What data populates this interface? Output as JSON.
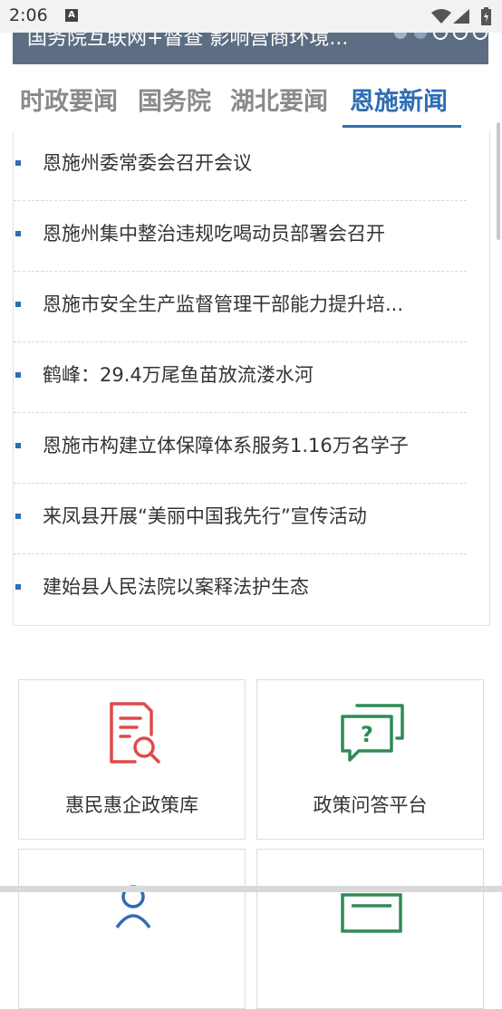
{
  "status_bar": {
    "time": "2:06",
    "notification_glyph": "A",
    "icons": [
      "wifi-icon",
      "signal-icon",
      "battery-icon"
    ]
  },
  "banner": {
    "caption": "国务院互联网+督查 影响营商环境..."
  },
  "tabs": [
    {
      "label": "时政要闻",
      "active": false
    },
    {
      "label": "国务院",
      "active": false
    },
    {
      "label": "湖北要闻",
      "active": false
    },
    {
      "label": "恩施新闻",
      "active": true
    }
  ],
  "news": [
    {
      "title": "恩施州委常委会召开会议"
    },
    {
      "title": "恩施州集中整治违规吃喝动员部署会召开"
    },
    {
      "title": "恩施市安全生产监督管理干部能力提升培..."
    },
    {
      "title": "鹤峰：29.4万尾鱼苗放流溇水河"
    },
    {
      "title": "恩施市构建立体保障体系服务1.16万名学子"
    },
    {
      "title": "来凤县开展“美丽中国我先行”宣传活动"
    },
    {
      "title": "建始县人民法院以案释法护生态"
    }
  ],
  "services": [
    {
      "label": "惠民惠企政策库",
      "icon": "policy-search-icon",
      "color": "#e04a4a"
    },
    {
      "label": "政策问答平台",
      "icon": "qa-chat-icon",
      "color": "#2e8b57"
    },
    {
      "label": "",
      "icon": "person-icon",
      "color": "#2f6db3"
    },
    {
      "label": "",
      "icon": "document-icon",
      "color": "#2e8b57"
    }
  ],
  "colors": {
    "accent": "#2f6db3",
    "banner_bg": "#5d6e84"
  }
}
